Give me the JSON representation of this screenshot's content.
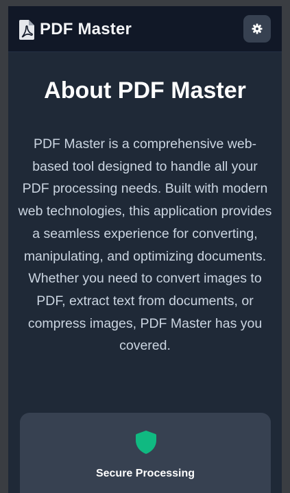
{
  "header": {
    "app_title": "PDF Master",
    "logo_icon": "file-pdf-icon",
    "settings_icon": "gear-icon"
  },
  "about": {
    "title": "About PDF Master",
    "description": "PDF Master is a comprehensive web-based tool designed to handle all your PDF processing needs. Built with modern web technologies, this application provides a seamless experience for converting, manipulating, and optimizing documents. Whether you need to convert images to PDF, extract text from documents, or compress images, PDF Master has you covered."
  },
  "features": [
    {
      "title": "Secure Processing",
      "icon": "shield-icon",
      "icon_color": "#10b981"
    }
  ],
  "colors": {
    "background": "#1f2937",
    "header": "#111827",
    "card": "#374151",
    "accent": "#10b981"
  }
}
